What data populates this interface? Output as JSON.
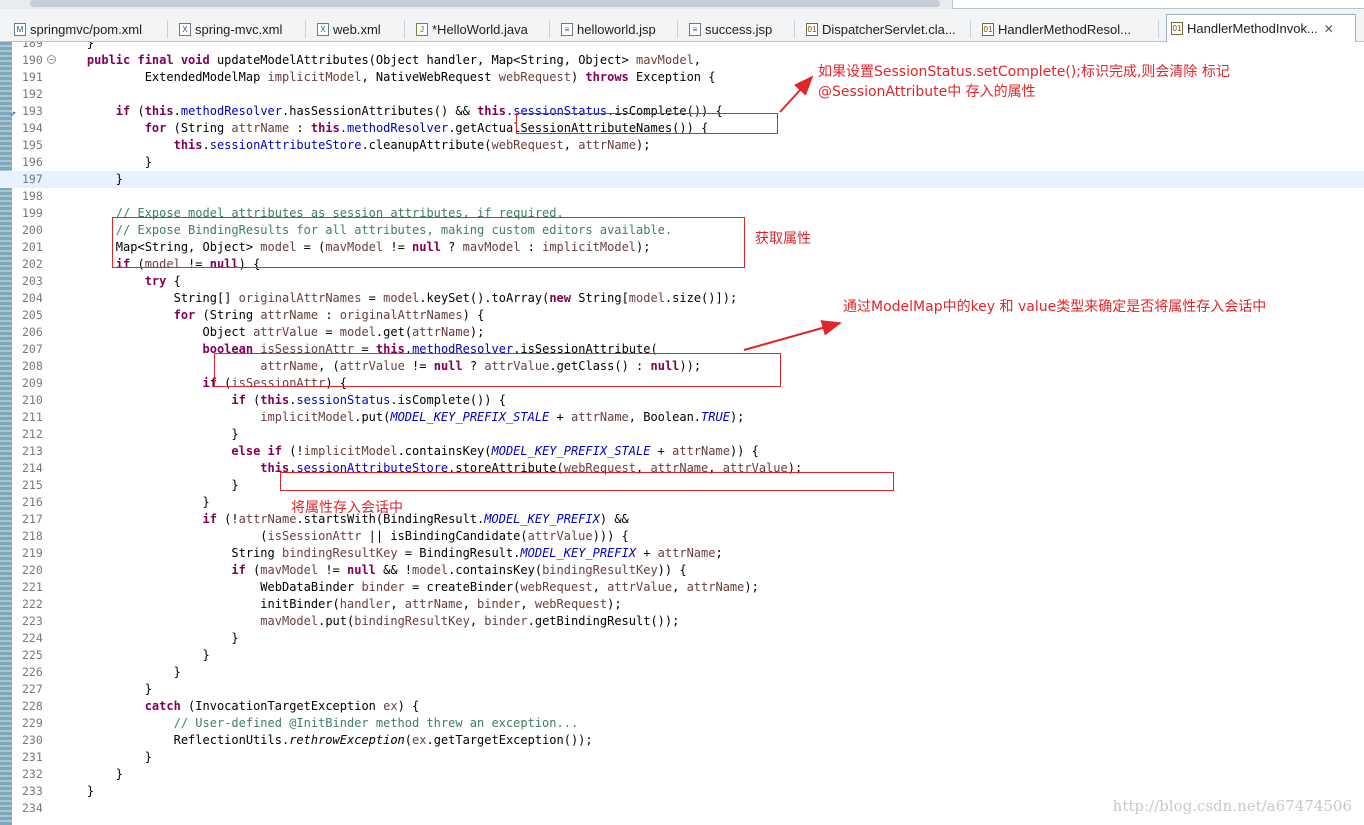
{
  "tabs": [
    {
      "label": "springmvc/pom.xml",
      "icon": "M"
    },
    {
      "label": "spring-mvc.xml",
      "icon": "X"
    },
    {
      "label": "web.xml",
      "icon": "X"
    },
    {
      "label": "*HelloWorld.java",
      "icon": "J"
    },
    {
      "label": "helloworld.jsp",
      "icon": "≡"
    },
    {
      "label": "success.jsp",
      "icon": "≡"
    },
    {
      "label": "DispatcherServlet.cla...",
      "icon": "01"
    },
    {
      "label": "HandlerMethodResol...",
      "icon": "01"
    },
    {
      "label": "HandlerMethodInvok...",
      "icon": "01",
      "active": true
    }
  ],
  "code_lines": [
    {
      "n": "189",
      "html": "    }"
    },
    {
      "n": "190",
      "html": "    <span class=\"kw\">public final void</span> updateModelAttributes(Object handler, Map&lt;String, Object&gt; <span class=\"ls\">mavModel</span>,",
      "fold": true
    },
    {
      "n": "191",
      "html": "            ExtendedModelMap <span class=\"ls\">implicitModel</span>, NativeWebRequest <span class=\"ls\">webRequest</span>) <span class=\"kw\">throws</span> Exception {"
    },
    {
      "n": "192",
      "html": ""
    },
    {
      "n": "193",
      "html": "        <span class=\"kw\">if</span> (<span class=\"kw\">this</span>.<span class=\"fd\">methodResolver</span>.hasSessionAttributes() &amp;&amp; <span class=\"kw\">this</span>.<span class=\"fd\">sessionStatus</span>.isComplete()) {",
      "mark": true
    },
    {
      "n": "194",
      "html": "            <span class=\"kw\">for</span> (String <span class=\"ls\">attrName</span> : <span class=\"kw\">this</span>.<span class=\"fd\">methodResolver</span>.getActualSessionAttributeNames()) {"
    },
    {
      "n": "195",
      "html": "                <span class=\"kw\">this</span>.<span class=\"fd\">sessionAttributeStore</span>.cleanupAttribute(<span class=\"ls\">webRequest</span>, <span class=\"ls\">attrName</span>);"
    },
    {
      "n": "196",
      "html": "            }"
    },
    {
      "n": "197",
      "html": "        }",
      "current": true
    },
    {
      "n": "198",
      "html": ""
    },
    {
      "n": "199",
      "html": "        <span class=\"cm\">// Expose model attributes as session attributes, if required.</span>"
    },
    {
      "n": "200",
      "html": "        <span class=\"cm\">// Expose BindingResults for all attributes, making custom editors available.</span>"
    },
    {
      "n": "201",
      "html": "        Map&lt;String, Object&gt; <span class=\"ls\">model</span> = (<span class=\"ls\">mavModel</span> != <span class=\"kw\">null</span> ? <span class=\"ls\">mavModel</span> : <span class=\"ls\">implicitModel</span>);"
    },
    {
      "n": "202",
      "html": "        <span class=\"kw\">if</span> (<span class=\"ls\">model</span> != <span class=\"kw\">null</span>) {"
    },
    {
      "n": "203",
      "html": "            <span class=\"kw\">try</span> {"
    },
    {
      "n": "204",
      "html": "                String[] <span class=\"ls\">originalAttrNames</span> = <span class=\"ls\">model</span>.keySet().toArray(<span class=\"kw\">new</span> String[<span class=\"ls\">model</span>.size()]);"
    },
    {
      "n": "205",
      "html": "                <span class=\"kw\">for</span> (String <span class=\"ls\">attrName</span> : <span class=\"ls\">originalAttrNames</span>) {"
    },
    {
      "n": "206",
      "html": "                    Object <span class=\"ls\">attrValue</span> = <span class=\"ls\">model</span>.get(<span class=\"ls\">attrName</span>);"
    },
    {
      "n": "207",
      "html": "                    <span class=\"kw\">boolean</span> <span class=\"ls\">isSessionAttr</span> = <span class=\"kw\">this</span>.<span class=\"fd\">methodResolver</span>.isSessionAttribute("
    },
    {
      "n": "208",
      "html": "                            <span class=\"ls\">attrName</span>, (<span class=\"ls\">attrValue</span> != <span class=\"kw\">null</span> ? <span class=\"ls\">attrValue</span>.getClass() : <span class=\"kw\">null</span>));"
    },
    {
      "n": "209",
      "html": "                    <span class=\"kw\">if</span> (<span class=\"ls\">isSessionAttr</span>) {"
    },
    {
      "n": "210",
      "html": "                        <span class=\"kw\">if</span> (<span class=\"kw\">this</span>.<span class=\"fd\">sessionStatus</span>.isComplete()) {"
    },
    {
      "n": "211",
      "html": "                            <span class=\"ls\">implicitModel</span>.put(<span class=\"sf\">MODEL_KEY_PREFIX_STALE</span> + <span class=\"ls\">attrName</span>, Boolean.<span class=\"sf\">TRUE</span>);"
    },
    {
      "n": "212",
      "html": "                        }"
    },
    {
      "n": "213",
      "html": "                        <span class=\"kw\">else if</span> (!<span class=\"ls\">implicitModel</span>.containsKey(<span class=\"sf\">MODEL_KEY_PREFIX_STALE</span> + <span class=\"ls\">attrName</span>)) {"
    },
    {
      "n": "214",
      "html": "                            <span class=\"kw\">this</span>.<span class=\"fd\">sessionAttributeStore</span>.storeAttribute(<span class=\"ls\">webRequest</span>, <span class=\"ls\">attrName</span>, <span class=\"ls\">attrValue</span>);"
    },
    {
      "n": "215",
      "html": "                        }"
    },
    {
      "n": "216",
      "html": "                    }"
    },
    {
      "n": "217",
      "html": "                    <span class=\"kw\">if</span> (!<span class=\"ls\">attrName</span>.startsWith(BindingResult.<span class=\"sf\">MODEL_KEY_PREFIX</span>) &amp;&amp;"
    },
    {
      "n": "218",
      "html": "                            (<span class=\"ls\">isSessionAttr</span> || isBindingCandidate(<span class=\"ls\">attrValue</span>))) {"
    },
    {
      "n": "219",
      "html": "                        String <span class=\"ls\">bindingResultKey</span> = BindingResult.<span class=\"sf\">MODEL_KEY_PREFIX</span> + <span class=\"ls\">attrName</span>;"
    },
    {
      "n": "220",
      "html": "                        <span class=\"kw\">if</span> (<span class=\"ls\">mavModel</span> != <span class=\"kw\">null</span> &amp;&amp; !<span class=\"ls\">model</span>.containsKey(<span class=\"ls\">bindingResultKey</span>)) {"
    },
    {
      "n": "221",
      "html": "                            WebDataBinder <span class=\"ls\">binder</span> = createBinder(<span class=\"ls\">webRequest</span>, <span class=\"ls\">attrValue</span>, <span class=\"ls\">attrName</span>);"
    },
    {
      "n": "222",
      "html": "                            initBinder(<span class=\"ls\">handler</span>, <span class=\"ls\">attrName</span>, <span class=\"ls\">binder</span>, <span class=\"ls\">webRequest</span>);"
    },
    {
      "n": "223",
      "html": "                            <span class=\"ls\">mavModel</span>.put(<span class=\"ls\">bindingResultKey</span>, <span class=\"ls\">binder</span>.getBindingResult());"
    },
    {
      "n": "224",
      "html": "                        }"
    },
    {
      "n": "225",
      "html": "                    }"
    },
    {
      "n": "226",
      "html": "                }"
    },
    {
      "n": "227",
      "html": "            }"
    },
    {
      "n": "228",
      "html": "            <span class=\"kw\">catch</span> (InvocationTargetException <span class=\"ls\">ex</span>) {"
    },
    {
      "n": "229",
      "html": "                <span class=\"cm\">// User-defined @InitBinder method threw an exception...</span>"
    },
    {
      "n": "230",
      "html": "                ReflectionUtils.<span class=\"it\">rethrowException</span>(<span class=\"ls\">ex</span>.getTargetException());"
    },
    {
      "n": "231",
      "html": "            }"
    },
    {
      "n": "232",
      "html": "        }"
    },
    {
      "n": "233",
      "html": "    }"
    },
    {
      "n": "234",
      "html": ""
    }
  ],
  "annotations": {
    "note1_line1": "如果设置SessionStatus.setComplete();标识完成,则会清除 标记",
    "note1_line2": "@SessionAttribute中 存入的属性",
    "note2": "获取属性",
    "note3": "通过ModelMap中的key 和 value类型来确定是否将属性存入会话中",
    "note4": "将属性存入会话中",
    "color": "#e0262a"
  },
  "watermark": "http://blog.csdn.net/a67474506"
}
